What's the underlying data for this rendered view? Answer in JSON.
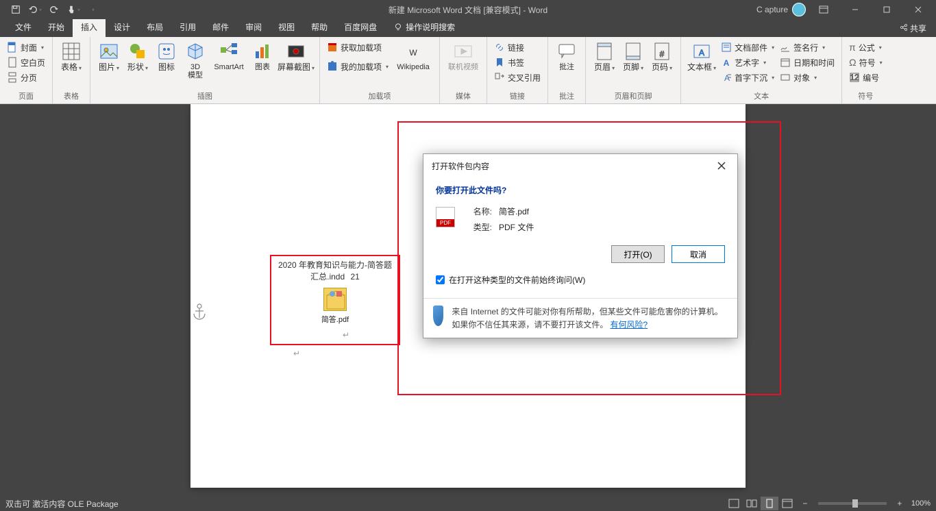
{
  "titlebar": {
    "title": "新建 Microsoft Word 文档 [兼容模式] - Word",
    "user": "C apture"
  },
  "tabs": {
    "file": "文件",
    "home": "开始",
    "insert": "插入",
    "design": "设计",
    "layout": "布局",
    "references": "引用",
    "mailings": "邮件",
    "review": "审阅",
    "view": "视图",
    "help": "帮助",
    "baidu": "百度网盘",
    "tellme": "操作说明搜索",
    "share": "共享"
  },
  "ribbon": {
    "pages": {
      "label": "页面",
      "cover": "封面",
      "blank": "空白页",
      "break": "分页"
    },
    "tables": {
      "label": "表格",
      "btn": "表格"
    },
    "illus": {
      "label": "插图",
      "picture": "图片",
      "shapes": "形状",
      "icons": "图标",
      "model3d": "3D\n模型",
      "smartart": "SmartArt",
      "chart": "图表",
      "screenshot": "屏幕截图"
    },
    "addins": {
      "label": "加载项",
      "store": "获取加载项",
      "my": "我的加载项"
    },
    "wiki": "Wikipedia",
    "media": {
      "label": "媒体",
      "video": "联机视频"
    },
    "links": {
      "label": "链接",
      "link": "链接",
      "bookmark": "书签",
      "xref": "交叉引用"
    },
    "comments": {
      "label": "批注",
      "btn": "批注"
    },
    "hf": {
      "label": "页眉和页脚",
      "header": "页眉",
      "footer": "页脚",
      "pagenum": "页码"
    },
    "text": {
      "label": "文本",
      "textbox": "文本框",
      "parts": "文档部件",
      "wordart": "艺术字",
      "dropcap": "首字下沉",
      "sigline": "签名行",
      "datetime": "日期和时间",
      "object": "对象"
    },
    "symbols": {
      "label": "符号",
      "equation": "公式",
      "symbol": "符号",
      "num": "编号"
    }
  },
  "embedded": {
    "heading": "2020 年教育知识与能力-简答题汇总.indd",
    "pg": "21",
    "filename": "简答.pdf"
  },
  "dialog": {
    "title": "打开软件包内容",
    "question": "你要打开此文件吗?",
    "name_k": "名称:",
    "name_v": "简答.pdf",
    "type_k": "类型:",
    "type_v": "PDF 文件",
    "open": "打开(O)",
    "cancel": "取消",
    "ask": "在打开这种类型的文件前始终询问(W)",
    "warn1": "来自 Internet 的文件可能对你有所帮助，但某些文件可能危害你的计算机。如果你不信任其来源，请不要打开该文件。",
    "risk": "有何风险?"
  },
  "status": {
    "left": "双击可 激活内容 OLE Package",
    "zoom": "100%"
  }
}
